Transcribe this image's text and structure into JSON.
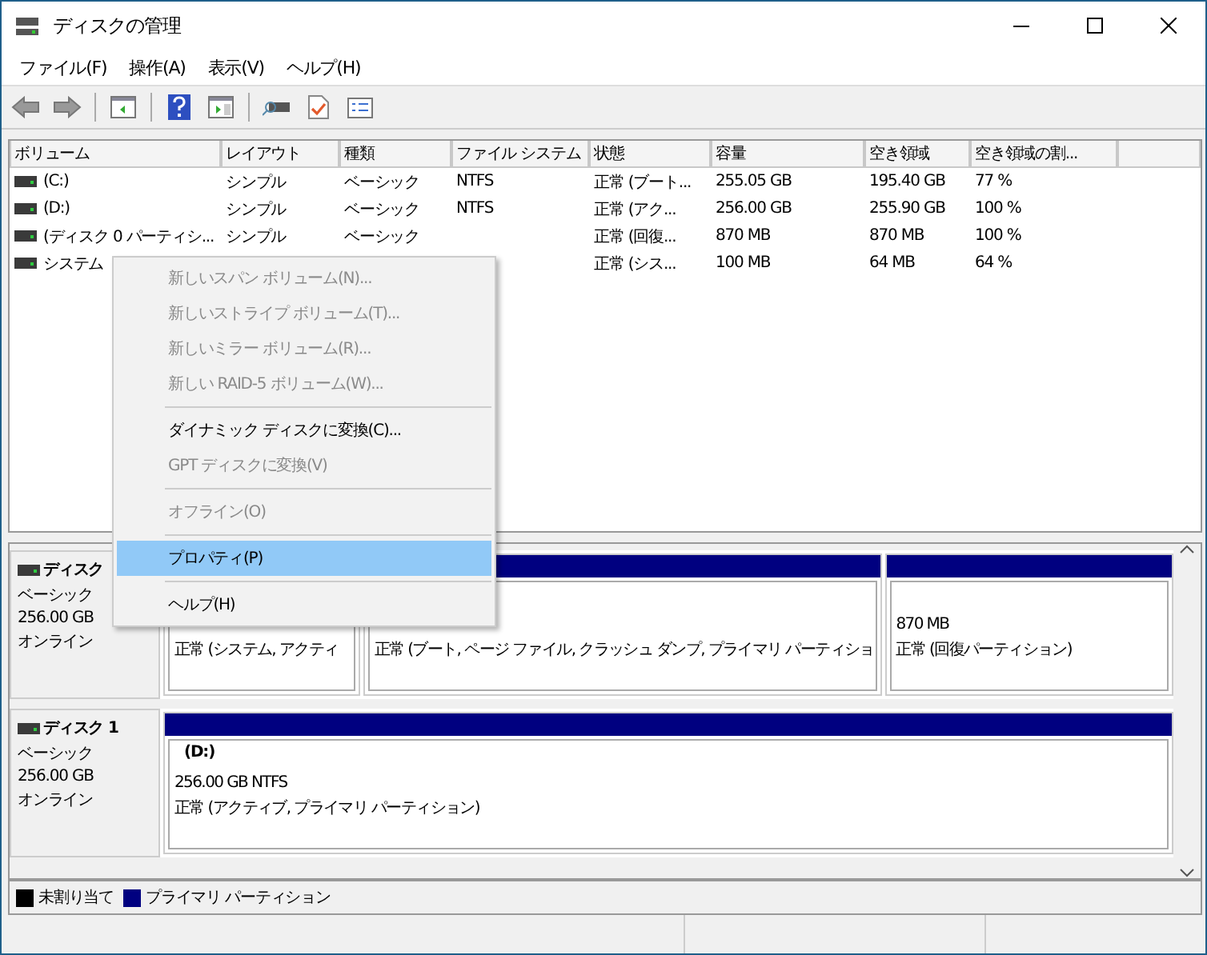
{
  "window": {
    "title": "ディスクの管理"
  },
  "menubar": [
    "ファイル(F)",
    "操作(A)",
    "表示(V)",
    "ヘルプ(H)"
  ],
  "table": {
    "columns": [
      "ボリューム",
      "レイアウト",
      "種類",
      "ファイル システム",
      "状態",
      "容量",
      "空き領域",
      "空き領域の割..."
    ],
    "rows": [
      [
        "(C:)",
        "シンプル",
        "ベーシック",
        "NTFS",
        "正常 (ブート...",
        "255.05 GB",
        "195.40 GB",
        "77 %"
      ],
      [
        "(D:)",
        "シンプル",
        "ベーシック",
        "NTFS",
        "正常 (アク...",
        "256.00 GB",
        "255.90 GB",
        "100 %"
      ],
      [
        "(ディスク 0 パーティシ...",
        "シンプル",
        "ベーシック",
        "",
        "正常 (回復...",
        "870 MB",
        "870 MB",
        "100 %"
      ],
      [
        "システム",
        "",
        "",
        "",
        "正常 (シス...",
        "100 MB",
        "64 MB",
        "64 %"
      ]
    ]
  },
  "disks": [
    {
      "name": "ディスク",
      "type": "ベーシック",
      "size": "256.00 GB",
      "status": "オンライン",
      "partitions": [
        {
          "lines": [
            "正常 (システム, アクティ"
          ]
        },
        {
          "lines": [
            "正常 (ブート, ページ ファイル, クラッシュ ダンプ, プライマリ パーティショ"
          ]
        },
        {
          "lines": [
            "870 MB",
            "正常 (回復パーティション)"
          ]
        }
      ]
    },
    {
      "name": "ディスク 1",
      "type": "ベーシック",
      "size": "256.00 GB",
      "status": "オンライン",
      "partitions": [
        {
          "title": "(D:)",
          "lines": [
            "256.00 GB NTFS",
            "正常 (アクティブ, プライマリ パーティション)"
          ]
        }
      ]
    }
  ],
  "legend": [
    {
      "label": "未割り当て",
      "color": "#000000"
    },
    {
      "label": "プライマリ パーティション",
      "color": "#000080"
    }
  ],
  "context_menu": [
    {
      "kind": "item",
      "label": "新しいスパン ボリューム(N)...",
      "disabled": true,
      "selected": false
    },
    {
      "kind": "item",
      "label": "新しいストライプ ボリューム(T)...",
      "disabled": true,
      "selected": false
    },
    {
      "kind": "item",
      "label": "新しいミラー ボリューム(R)...",
      "disabled": true,
      "selected": false
    },
    {
      "kind": "item",
      "label": "新しい RAID-5 ボリューム(W)...",
      "disabled": true,
      "selected": false
    },
    {
      "kind": "separator"
    },
    {
      "kind": "item",
      "label": "ダイナミック ディスクに変換(C)...",
      "disabled": false,
      "selected": false
    },
    {
      "kind": "item",
      "label": "GPT ディスクに変換(V)",
      "disabled": true,
      "selected": false
    },
    {
      "kind": "separator"
    },
    {
      "kind": "item",
      "label": "オフライン(O)",
      "disabled": true,
      "selected": false
    },
    {
      "kind": "separator"
    },
    {
      "kind": "item",
      "label": "プロパティ(P)",
      "disabled": false,
      "selected": true
    },
    {
      "kind": "separator"
    },
    {
      "kind": "item",
      "label": "ヘルプ(H)",
      "disabled": false,
      "selected": false
    }
  ]
}
